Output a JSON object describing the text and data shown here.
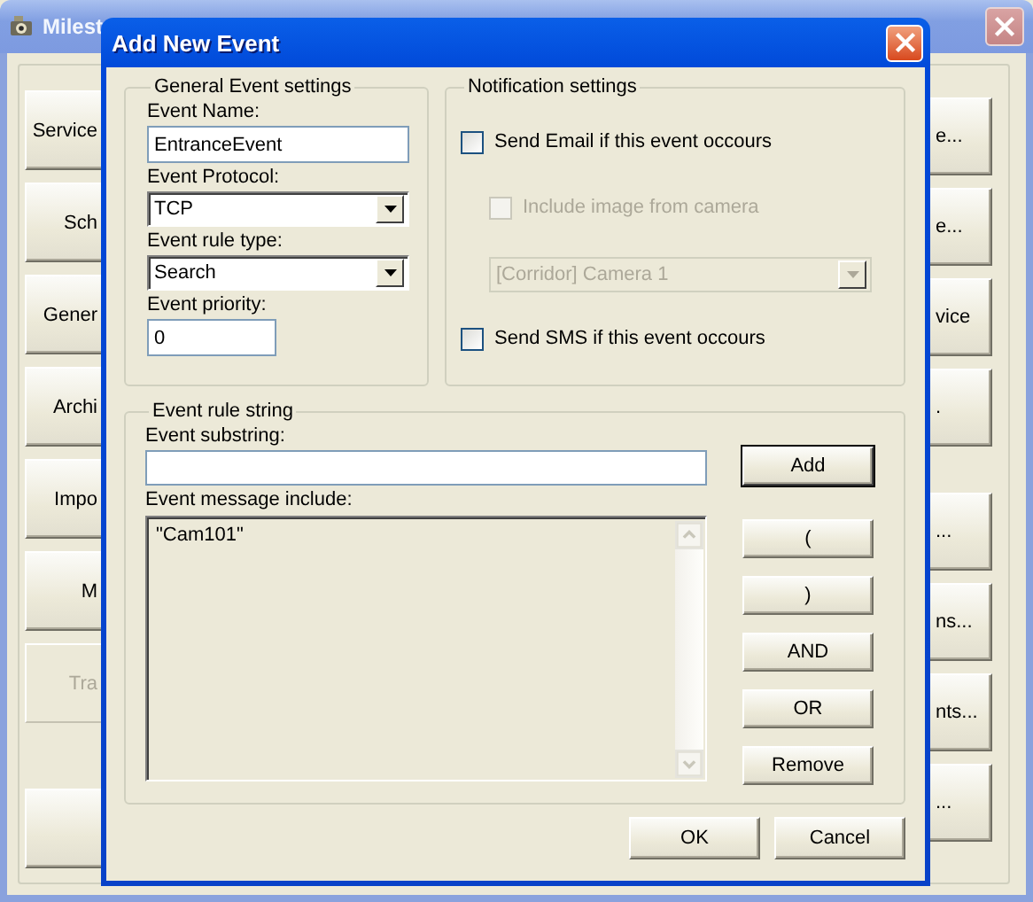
{
  "background_window": {
    "title": "Milest",
    "left_buttons": [
      {
        "label": "Service",
        "disabled": false
      },
      {
        "label": "Sch",
        "disabled": false
      },
      {
        "label": "Gener",
        "disabled": false
      },
      {
        "label": "Archi",
        "disabled": false
      },
      {
        "label": "Impo",
        "disabled": false
      },
      {
        "label": "M",
        "disabled": false
      },
      {
        "label": "Tra",
        "disabled": true
      },
      {
        "disabled": false
      }
    ],
    "right_buttons": [
      {
        "label": "e...",
        "disabled": false
      },
      {
        "label": "e...",
        "disabled": false
      },
      {
        "label": "vice",
        "disabled": false
      },
      {
        "label": ".",
        "disabled": false
      },
      {
        "label": "...",
        "disabled": false
      },
      {
        "label": "ns...",
        "disabled": false
      },
      {
        "label": "nts...",
        "disabled": false
      },
      {
        "label": "...",
        "disabled": false
      }
    ]
  },
  "dialog": {
    "title": "Add New Event",
    "general": {
      "title": "General Event settings",
      "event_name": {
        "label": "Event Name:",
        "value": "EntranceEvent"
      },
      "event_protocol": {
        "label": "Event Protocol:",
        "value": "TCP"
      },
      "event_rule_type": {
        "label": "Event rule type:",
        "value": "Search"
      },
      "event_priority": {
        "label": "Event priority:",
        "value": "0"
      }
    },
    "notification": {
      "title": "Notification settings",
      "send_email": {
        "label": "Send Email if this event occours",
        "checked": false,
        "disabled": false
      },
      "include_image": {
        "label": "Include image from camera",
        "checked": false,
        "disabled": true
      },
      "camera": {
        "value": "[Corridor] Camera 1",
        "disabled": true
      },
      "send_sms": {
        "label": "Send SMS if this event occours",
        "checked": false,
        "disabled": false
      }
    },
    "rule": {
      "title": "Event rule string",
      "substring": {
        "label": "Event substring:"
      },
      "message_include": {
        "label": "Event message include:",
        "items": [
          "\"Cam101\""
        ]
      },
      "buttons": [
        {
          "label": "Add",
          "default": true
        },
        {
          "label": "(",
          "default": false
        },
        {
          "label": ")",
          "default": false
        },
        {
          "label": "AND",
          "default": false
        },
        {
          "label": "OR",
          "default": false
        },
        {
          "label": "Remove",
          "default": false
        }
      ]
    },
    "buttons": [
      {
        "label": "OK"
      },
      {
        "label": "Cancel"
      }
    ]
  }
}
